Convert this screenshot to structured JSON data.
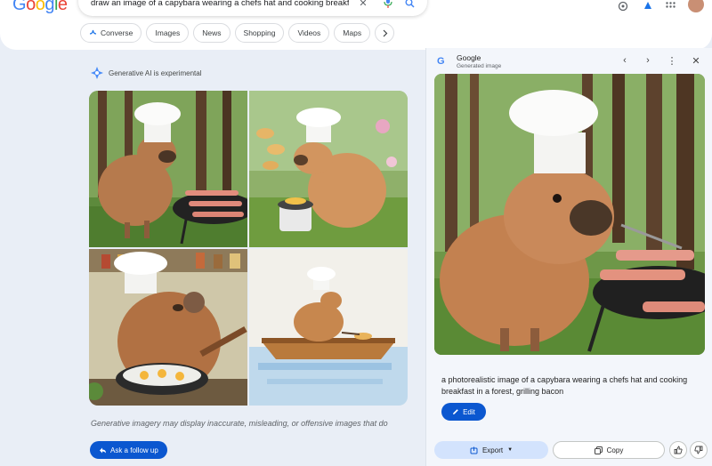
{
  "header": {
    "logo_text": "Google",
    "search_query": "draw an image of a capybara wearing a chefs hat and cooking breakfast",
    "icons": [
      "clear-icon",
      "mic-icon",
      "search-icon",
      "labs-icon",
      "apps-icon",
      "avatar"
    ],
    "chips": [
      {
        "label": "Converse",
        "icon": "sparkle-icon"
      },
      {
        "label": "Images"
      },
      {
        "label": "News"
      },
      {
        "label": "Shopping"
      },
      {
        "label": "Videos"
      },
      {
        "label": "Maps"
      }
    ]
  },
  "main": {
    "badge_text": "Generative AI is experimental",
    "disclaimer": "Generative imagery may display inaccurate, misleading, or offensive images that do",
    "followup_label": "Ask a follow up"
  },
  "side": {
    "title": "Google",
    "subtitle": "Generated image",
    "prompt_text": "a photorealistic image of a capybara wearing a chefs hat and cooking breakfast in a forest, grilling bacon",
    "edit_label": "Edit",
    "export_label": "Export",
    "copy_label": "Copy"
  },
  "colors": {
    "accent": "#0b57d0",
    "export_bg": "#d3e3fd",
    "page_bg": "#e9eef6"
  }
}
